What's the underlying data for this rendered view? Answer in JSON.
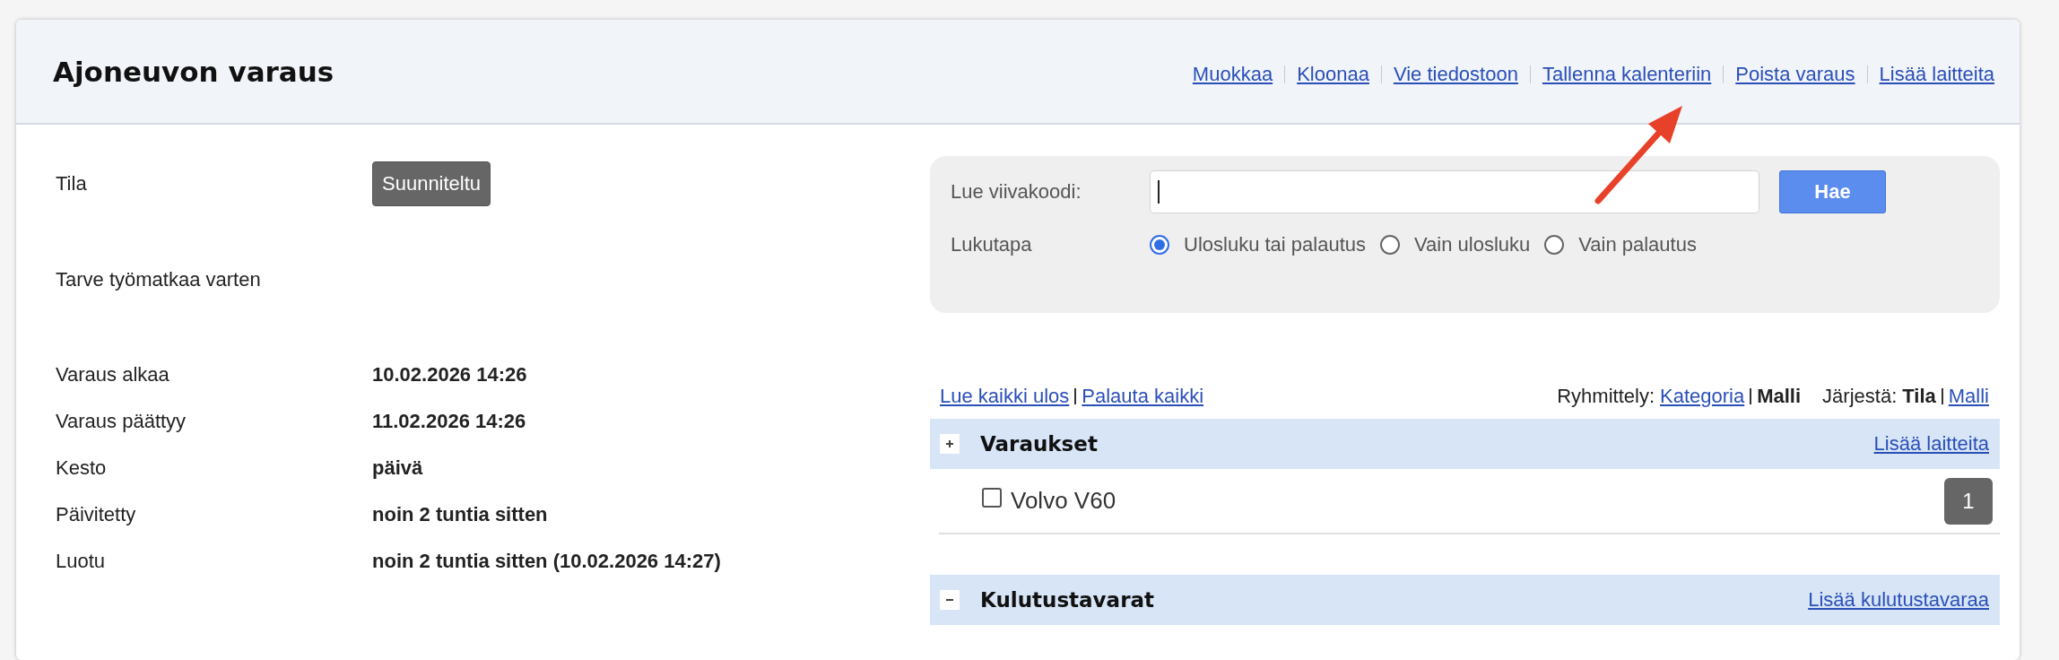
{
  "header": {
    "title": "Ajoneuvon varaus",
    "actions": [
      "Muokkaa",
      "Kloonaa",
      "Vie tiedostoon",
      "Tallenna kalenteriin",
      "Poista varaus",
      "Lisää laitteita"
    ]
  },
  "details": [
    {
      "kind": "badge",
      "label": "Tila",
      "value": "Suunniteltu"
    },
    {
      "kind": "label",
      "label": "Tarve työmatkaa varten"
    },
    {
      "kind": "text",
      "label": "Varaus alkaa",
      "value": "10.02.2026 14:26"
    },
    {
      "kind": "text",
      "label": "Varaus päättyy",
      "value": "11.02.2026 14:26"
    },
    {
      "kind": "text",
      "label": "Kesto",
      "value": "päivä"
    },
    {
      "kind": "text",
      "label": "Päivitetty",
      "value": "noin 2 tuntia sitten"
    },
    {
      "kind": "text",
      "label": "Luotu",
      "value": "noin 2 tuntia sitten (10.02.2026 14:27)"
    }
  ],
  "scanner": {
    "label": "Lue viivakoodi:",
    "button": "Hae",
    "mode_label": "Lukutapa",
    "modes": [
      {
        "label": "Ulosluku tai palautus",
        "selected": true
      },
      {
        "label": "Vain ulosluku",
        "selected": false
      },
      {
        "label": "Vain palautus",
        "selected": false
      }
    ]
  },
  "bulk_actions": [
    "Lue kaikki ulos",
    "Palauta kaikki"
  ],
  "grouping": {
    "label": "Ryhmittely:",
    "options": [
      {
        "label": "Kategoria",
        "selected": false
      },
      {
        "label": "Malli",
        "selected": true
      }
    ]
  },
  "sorting": {
    "label": "Järjestä:",
    "options": [
      {
        "label": "Tila",
        "selected": true
      },
      {
        "label": "Malli",
        "selected": false
      }
    ]
  },
  "sections": [
    {
      "title": "Varaukset",
      "expanded": false,
      "action": "Lisää laitteita",
      "items": [
        {
          "name": "Volvo V60",
          "checked": false,
          "count": "1"
        }
      ]
    },
    {
      "title": "Kulutustavarat",
      "expanded": true,
      "action": "Lisää kulutustavaraa"
    }
  ]
}
